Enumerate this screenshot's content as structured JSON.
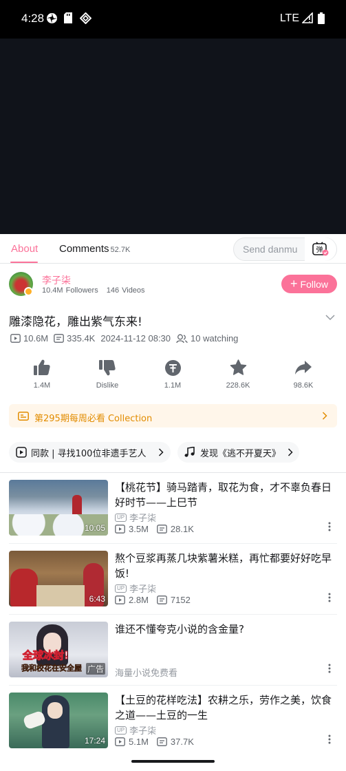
{
  "status_bar": {
    "time": "4:28",
    "network": "LTE"
  },
  "tabs": {
    "about_label": "About",
    "comments_label": "Comments",
    "comments_count": "52.7K",
    "danmu_placeholder": "Send danmu",
    "danmu_icon_char": "弹"
  },
  "uploader": {
    "name": "李子柒",
    "followers": "10.4M Followers",
    "videos": "146 Videos",
    "follow_label": "Follow"
  },
  "video": {
    "title": "雕漆隐花，雕出紫气东来!",
    "views": "10.6M",
    "danmaku": "335.4K",
    "date": "2024-11-12 08:30",
    "watching": "10 watching"
  },
  "actions": [
    {
      "icon": "like-icon",
      "label": "1.4M"
    },
    {
      "icon": "dislike-icon",
      "label": "Dislike"
    },
    {
      "icon": "coin-icon",
      "label": "1.1M"
    },
    {
      "icon": "favorite-icon",
      "label": "228.6K"
    },
    {
      "icon": "share-icon",
      "label": "98.6K"
    }
  ],
  "collection": {
    "text": "第295期每周必看 Collection"
  },
  "tags": [
    {
      "text": "同款 | 寻找100位非遗手艺人"
    },
    {
      "text": "发现《逃不开夏天》"
    }
  ],
  "feed": [
    {
      "title": "【桃花节】骑马踏青，取花为食，才不辜负春日好时节——上巳节",
      "author": "李子柒",
      "views": "3.5M",
      "danmaku": "28.1K",
      "duration": "10:05"
    },
    {
      "title": "熬个豆浆再蒸几块紫薯米糕，再忙都要好好吃早饭!",
      "author": "李子柒",
      "views": "2.8M",
      "danmaku": "7152",
      "duration": "6:43"
    },
    {
      "title": "谁还不懂夸克小说的含金量?",
      "source": "海量小说免费看",
      "badge": "广告",
      "thumb_text_1": "全球冰封!",
      "thumb_text_2": "我和校花在安全屋"
    },
    {
      "title": "【土豆的花样吃法】农耕之乐，劳作之美，饮食之道——土豆的一生",
      "author": "李子柒",
      "views": "5.1M",
      "danmaku": "37.7K",
      "duration": "17:24"
    }
  ],
  "colors": {
    "accent": "#fb7299",
    "collection_bg": "#fff6ea",
    "collection_text": "#e28c00"
  }
}
